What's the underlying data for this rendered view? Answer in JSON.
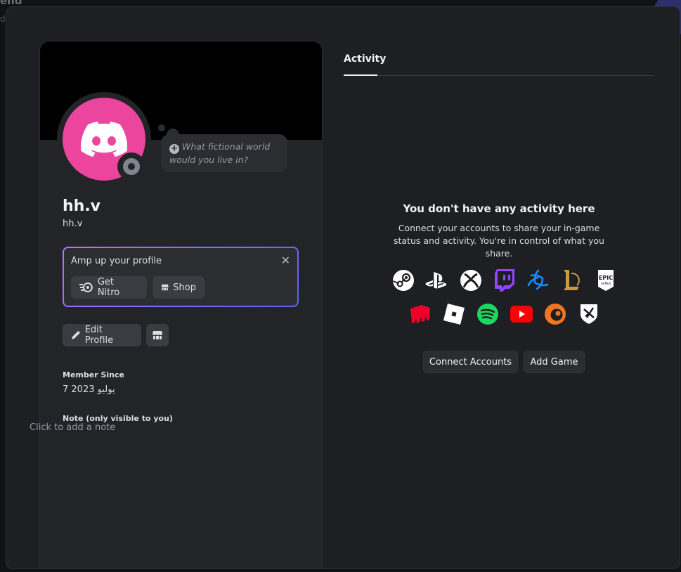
{
  "background": {
    "peek_text": "end",
    "peek_text2": "d"
  },
  "profile": {
    "display_name": "hh.v",
    "username": "hh.v",
    "custom_status_prompt": "What fictional world would you live in?",
    "avatar_color": "#eb459e",
    "status": "offline"
  },
  "nitro_promo": {
    "title": "Amp up your profile",
    "get_nitro_label": "Get Nitro",
    "shop_label": "Shop"
  },
  "actions": {
    "edit_profile_label": "Edit Profile"
  },
  "member_since": {
    "label": "Member Since",
    "value": "7 يوليو 2023"
  },
  "note": {
    "label": "Note (only visible to you)",
    "placeholder": "Click to add a note"
  },
  "activity": {
    "tab_label": "Activity",
    "empty_title": "You don't have any activity here",
    "empty_sub": "Connect your accounts to share your in-game status and activity. You're in control of what you share.",
    "services_row1": [
      "steam-icon",
      "playstation-icon",
      "xbox-icon",
      "twitch-icon",
      "battlenet-icon",
      "league-of-legends-icon",
      "epic-games-icon"
    ],
    "services_row2": [
      "riot-games-icon",
      "roblox-icon",
      "spotify-icon",
      "youtube-icon",
      "crunchyroll-icon",
      "bungie-icon"
    ],
    "connect_label": "Connect Accounts",
    "add_game_label": "Add Game"
  },
  "colors": {
    "modal_bg": "#1e1f22",
    "card_bg": "#232428",
    "accent_gradient": [
      "#b473f5",
      "#5865f2"
    ]
  }
}
